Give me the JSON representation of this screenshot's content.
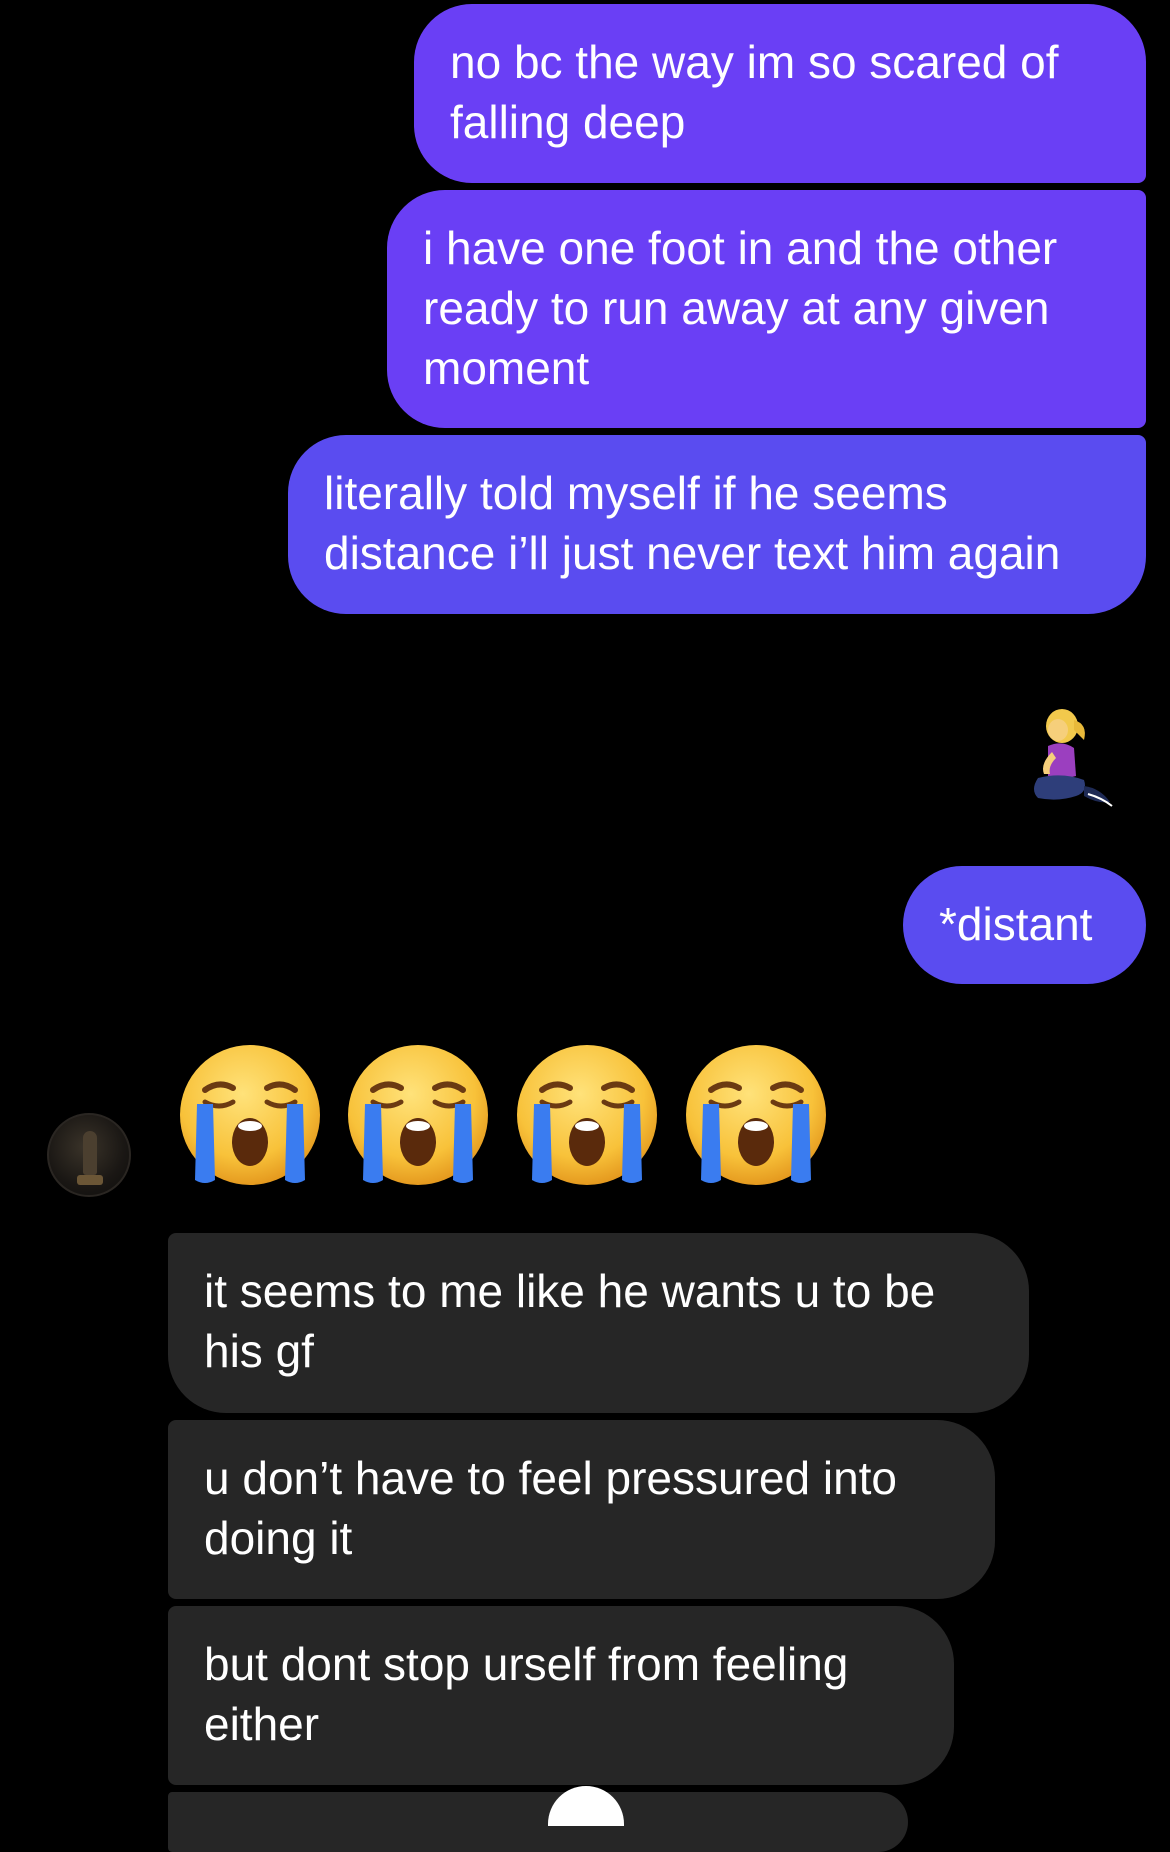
{
  "conversation": {
    "messages": [
      {
        "from": "me",
        "text": "no bc the way im so scared of falling deep"
      },
      {
        "from": "me",
        "text": "i have one foot in and the other ready to run away at any given moment"
      },
      {
        "from": "me",
        "text": "literally told myself if he seems distance i’ll just never text him again"
      },
      {
        "from": "me",
        "emoji": "woman-kneeling-emoji"
      },
      {
        "from": "me",
        "text": "*distant"
      },
      {
        "from": "them",
        "emoji": "loudly-crying-face-emoji",
        "count": 4
      },
      {
        "from": "them",
        "text": "it seems to me like he wants u to be his gf"
      },
      {
        "from": "them",
        "text": "u don’t have to feel pressured into doing it"
      },
      {
        "from": "them",
        "text": "but dont stop urself from feeling either"
      }
    ]
  },
  "colors": {
    "background": "#000000",
    "sent_bubble": "#6a3ff5",
    "sent_bubble_late": "#5a4cf0",
    "received_bubble": "#262626",
    "text": "#ffffff"
  },
  "icons": {
    "avatar": "contact-avatar",
    "kneel": "woman-kneeling-emoji",
    "cry": "loudly-crying-face-emoji"
  }
}
